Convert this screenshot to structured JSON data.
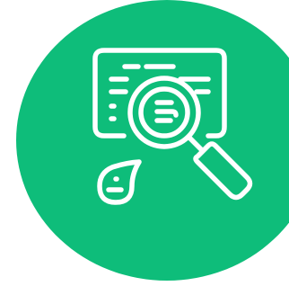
{
  "illustration": {
    "icon": "document-search-magnifier-icon",
    "background_color": "#0ebd7a",
    "line_color": "#ffffff",
    "background_shape": "circle"
  }
}
